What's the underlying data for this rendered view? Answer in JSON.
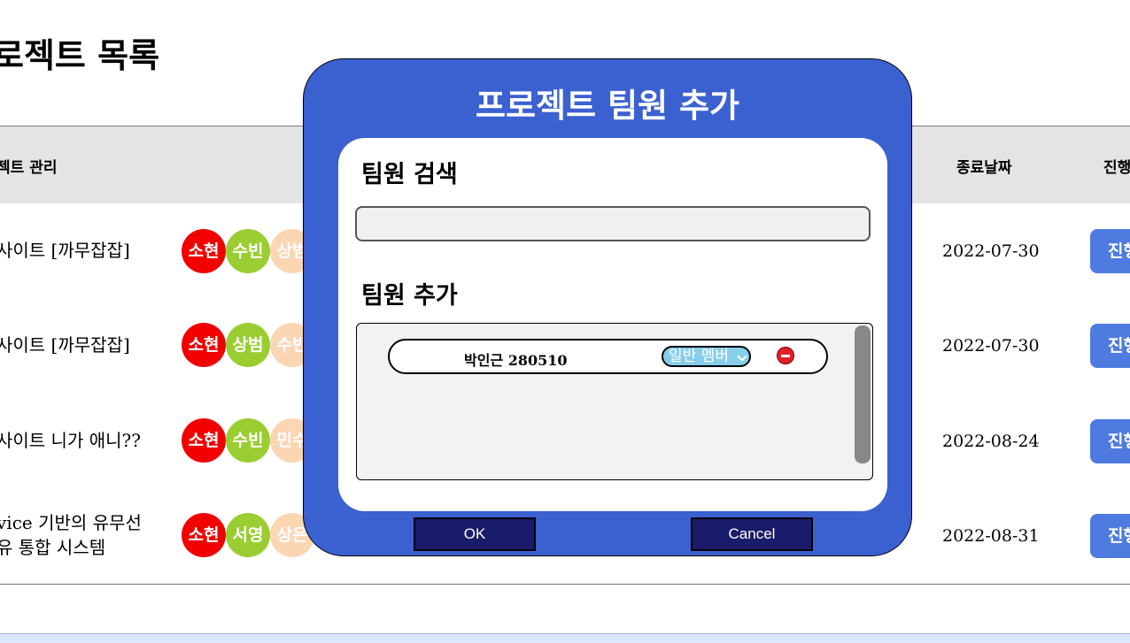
{
  "page": {
    "title": "로젝트 목록"
  },
  "table": {
    "headers": {
      "name": "젝트 관리",
      "end_date": "종료날짜",
      "status": "진행"
    },
    "rows": [
      {
        "name_lines": [
          "사이트 [까무잡잡]"
        ],
        "members": [
          {
            "label": "소현",
            "color": "#f20000"
          },
          {
            "label": "수빈",
            "color": "#9acd32"
          },
          {
            "label": "상범",
            "color": "#fbd6b3"
          }
        ],
        "end_date": "2022-07-30",
        "status": "진행"
      },
      {
        "name_lines": [
          "사이트 [까무잡잡]"
        ],
        "members": [
          {
            "label": "소현",
            "color": "#f20000"
          },
          {
            "label": "상범",
            "color": "#9acd32"
          },
          {
            "label": "수빈",
            "color": "#fbd6b3"
          }
        ],
        "end_date": "2022-07-30",
        "status": "진행"
      },
      {
        "name_lines": [
          " 사이트 니가 애니??"
        ],
        "members": [
          {
            "label": "소현",
            "color": "#f20000"
          },
          {
            "label": "수빈",
            "color": "#9acd32"
          },
          {
            "label": "민수",
            "color": "#fbd6b3"
          }
        ],
        "end_date": "2022-08-24",
        "status": "진행"
      },
      {
        "name_lines": [
          "vice 기반의 유무선",
          "유 통합 시스템"
        ],
        "members": [
          {
            "label": "소현",
            "color": "#f20000"
          },
          {
            "label": "서영",
            "color": "#9acd32"
          },
          {
            "label": "상은",
            "color": "#fbd6b3"
          }
        ],
        "end_date": "2022-08-31",
        "status": "진행"
      }
    ]
  },
  "modal": {
    "title": "프로젝트 팀원 추가",
    "search_label": "팀원 검색",
    "search_value": "",
    "add_label": "팀원 추가",
    "members": [
      {
        "name": "박인근 280510",
        "role": "일반 멤버"
      }
    ],
    "ok_label": "OK",
    "cancel_label": "Cancel"
  },
  "colors": {
    "modal_bg": "#3b61d1",
    "button_bg": "#1b1b6b",
    "status_button": "#4f7be0",
    "role_select": "#87ceeb"
  }
}
